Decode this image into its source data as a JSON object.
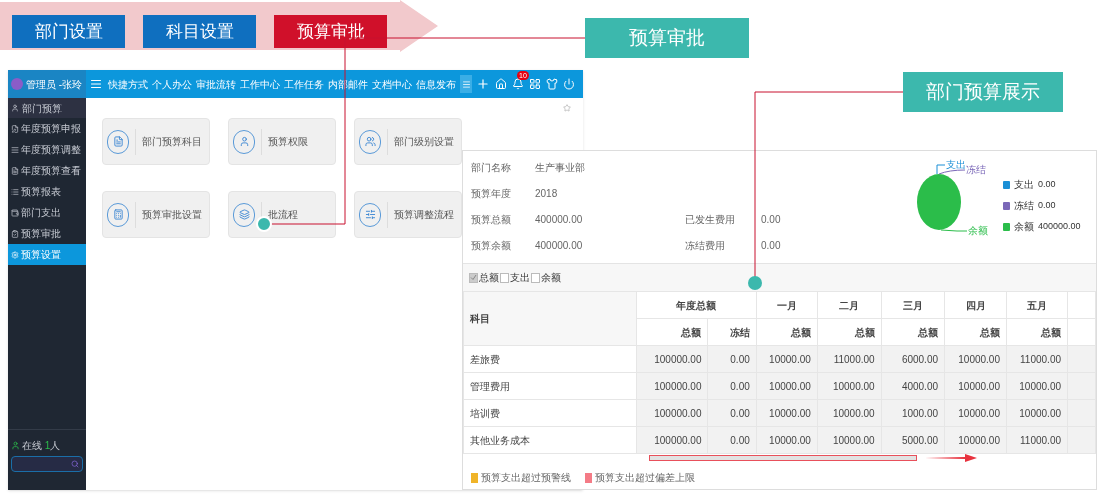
{
  "top_tabs": [
    {
      "label": "部门设置",
      "selected": false
    },
    {
      "label": "科目设置",
      "selected": false
    },
    {
      "label": "预算审批",
      "selected": true
    }
  ],
  "callouts": [
    {
      "label": "预算审批"
    },
    {
      "label": "部门预算展示"
    }
  ],
  "app": {
    "user": "管理员 -张玲",
    "nav": [
      "快捷方式",
      "个人办公",
      "审批流转",
      "工作中心",
      "工作任务",
      "内部邮件",
      "文档中心",
      "信息发布"
    ],
    "badge": "10",
    "sidebar": {
      "section": "部门预算",
      "items": [
        {
          "label": "年度预算申报",
          "selected": false
        },
        {
          "label": "年度预算调整",
          "selected": false
        },
        {
          "label": "年度预算查看",
          "selected": false
        },
        {
          "label": "预算报表",
          "selected": false
        },
        {
          "label": "部门支出",
          "selected": false
        },
        {
          "label": "预算审批",
          "selected": false
        },
        {
          "label": "预算设置",
          "selected": true
        }
      ],
      "online_label": "在线",
      "online_count": "1",
      "online_unit": "人"
    },
    "cards": [
      {
        "label": "部门预算科目",
        "kind": "document"
      },
      {
        "label": "预算权限",
        "kind": "person"
      },
      {
        "label": "部门级别设置",
        "kind": "people"
      },
      {
        "label": "预算审批设置",
        "kind": "calculator"
      },
      {
        "label": "批流程",
        "kind": "layers"
      },
      {
        "label": "预算调整流程",
        "kind": "sliders"
      }
    ]
  },
  "panel": {
    "info": [
      {
        "label": "部门名称",
        "value": "生产事业部"
      },
      {
        "label": "预算年度",
        "value": "2018"
      },
      {
        "label": "预算总额",
        "value": "400000.00",
        "label2": "已发生费用",
        "value2": "0.00"
      },
      {
        "label": "预算余额",
        "value": "400000.00",
        "label2": "冻结费用",
        "value2": "0.00"
      }
    ],
    "chart_data": {
      "type": "pie",
      "categories": [
        "支出",
        "冻结",
        "余额"
      ],
      "values": [
        0,
        0,
        100
      ]
    },
    "legend": [
      {
        "label": "支出",
        "value": "0.00",
        "color": "#1b8fd6"
      },
      {
        "label": "冻结",
        "value": "0.00",
        "color": "#7b68b8"
      },
      {
        "label": "余额",
        "value": "400000.00",
        "color": "#2bbd4a"
      }
    ],
    "filters": [
      {
        "label": "总额",
        "checked": true
      },
      {
        "label": "支出",
        "checked": false
      },
      {
        "label": "余额",
        "checked": false
      }
    ],
    "table": {
      "subject_header": "科目",
      "groups": [
        {
          "label": "年度总额",
          "subs": [
            "总额",
            "冻结"
          ]
        },
        {
          "label": "一月",
          "subs": [
            "总额"
          ]
        },
        {
          "label": "二月",
          "subs": [
            "总额"
          ]
        },
        {
          "label": "三月",
          "subs": [
            "总额"
          ]
        },
        {
          "label": "四月",
          "subs": [
            "总额"
          ]
        },
        {
          "label": "五月",
          "subs": [
            "总额"
          ]
        }
      ],
      "rows": [
        {
          "subject": "差旅费",
          "cells": [
            "100000.00",
            "0.00",
            "10000.00",
            "11000.00",
            "6000.00",
            "10000.00",
            "11000.00"
          ]
        },
        {
          "subject": "管理费用",
          "cells": [
            "100000.00",
            "0.00",
            "10000.00",
            "10000.00",
            "4000.00",
            "10000.00",
            "10000.00"
          ]
        },
        {
          "subject": "培训费",
          "cells": [
            "100000.00",
            "0.00",
            "10000.00",
            "10000.00",
            "1000.00",
            "10000.00",
            "10000.00"
          ]
        },
        {
          "subject": "其他业务成本",
          "cells": [
            "100000.00",
            "0.00",
            "10000.00",
            "10000.00",
            "5000.00",
            "10000.00",
            "11000.00"
          ]
        }
      ]
    },
    "notes": [
      {
        "label": "预算支出超过预警线",
        "color": "#f0b429"
      },
      {
        "label": "预算支出超过偏差上限",
        "color": "#f47b86"
      }
    ]
  }
}
